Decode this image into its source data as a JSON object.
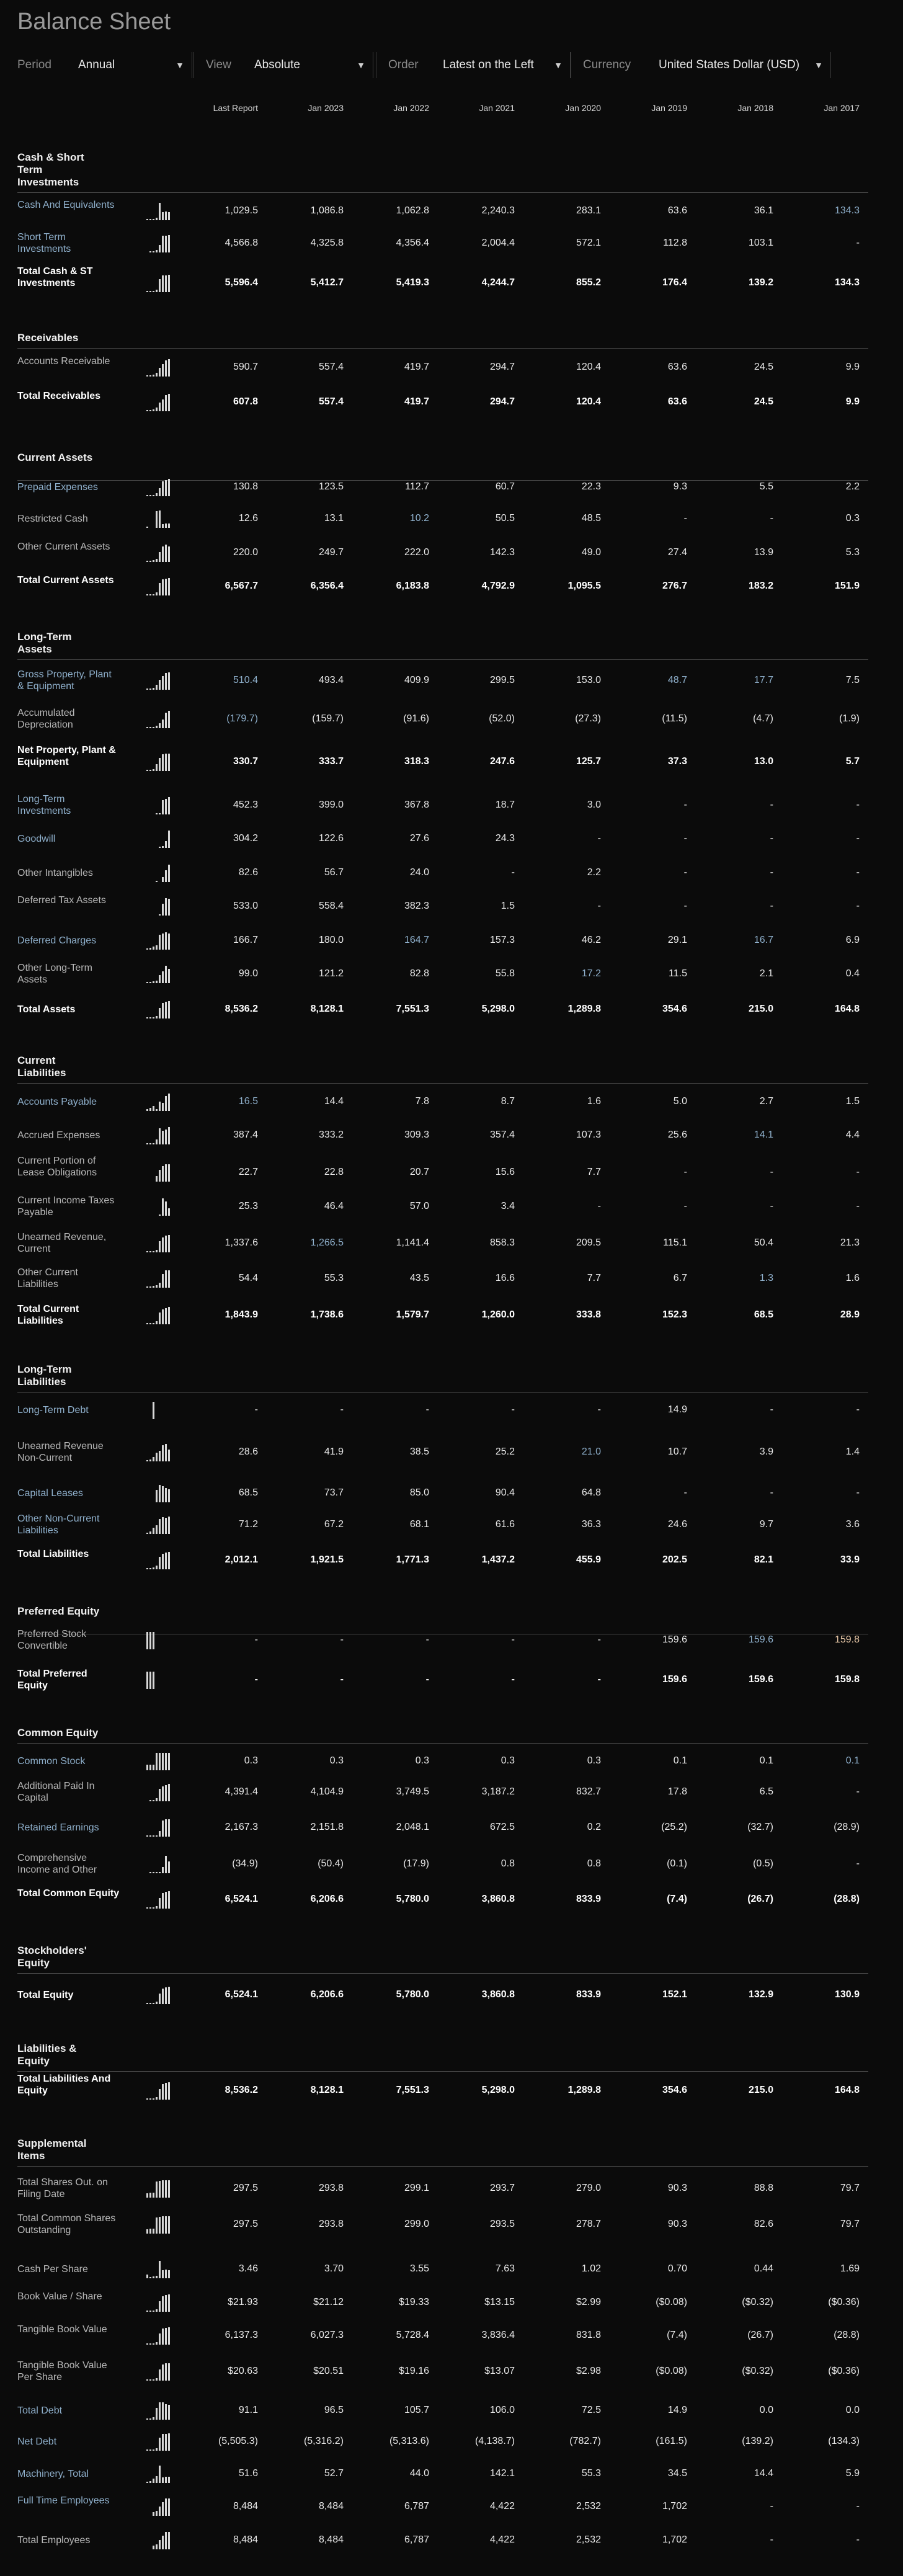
{
  "title": "Balance Sheet",
  "controls": [
    {
      "label": "Period",
      "value": "Annual"
    },
    {
      "label": "View",
      "value": "Absolute"
    },
    {
      "label": "Order",
      "value": "Latest on the Left"
    },
    {
      "label": "Currency",
      "value": "United States Dollar (USD)"
    }
  ],
  "caret_icon": "▼",
  "columns": [
    "Last Report",
    "Jan 2023",
    "Jan 2022",
    "Jan 2021",
    "Jan 2020",
    "Jan 2019",
    "Jan 2018",
    "Jan 2017"
  ],
  "colors": {
    "link": "#8fb0cc",
    "amber": "#e8c8a8",
    "bg": "#0b0b0b"
  },
  "sections": [
    {
      "title": "Cash & Short Term Investments",
      "rows": [
        {
          "label": "Cash And Equivalents",
          "style": "link",
          "values": [
            "1,029.5",
            "1,086.8",
            "1,062.8",
            "2,240.3",
            "283.1",
            "63.6",
            "36.1",
            "134.3"
          ],
          "blue": [
            7
          ]
        },
        {
          "label": "Short Term Investments",
          "style": "link",
          "values": [
            "4,566.8",
            "4,325.8",
            "4,356.4",
            "2,004.4",
            "572.1",
            "112.8",
            "103.1",
            "-"
          ]
        },
        {
          "label": "Total Cash & ST Investments",
          "style": "total",
          "values": [
            "5,596.4",
            "5,412.7",
            "5,419.3",
            "4,244.7",
            "855.2",
            "176.4",
            "139.2",
            "134.3"
          ]
        }
      ]
    },
    {
      "title": "Receivables",
      "rows": [
        {
          "label": "Accounts Receivable",
          "style": "plain",
          "values": [
            "590.7",
            "557.4",
            "419.7",
            "294.7",
            "120.4",
            "63.6",
            "24.5",
            "9.9"
          ]
        },
        {
          "label": "Total Receivables",
          "style": "total",
          "values": [
            "607.8",
            "557.4",
            "419.7",
            "294.7",
            "120.4",
            "63.6",
            "24.5",
            "9.9"
          ]
        }
      ]
    },
    {
      "title": "Current Assets",
      "rows": [
        {
          "label": "Prepaid Expenses",
          "style": "link",
          "values": [
            "130.8",
            "123.5",
            "112.7",
            "60.7",
            "22.3",
            "9.3",
            "5.5",
            "2.2"
          ]
        },
        {
          "label": "Restricted Cash",
          "style": "plain",
          "values": [
            "12.6",
            "13.1",
            "10.2",
            "50.5",
            "48.5",
            "-",
            "-",
            "0.3"
          ],
          "blue": [
            2
          ]
        },
        {
          "label": "Other Current Assets",
          "style": "plain",
          "values": [
            "220.0",
            "249.7",
            "222.0",
            "142.3",
            "49.0",
            "27.4",
            "13.9",
            "5.3"
          ]
        },
        {
          "label": "Total Current Assets",
          "style": "total",
          "values": [
            "6,567.7",
            "6,356.4",
            "6,183.8",
            "4,792.9",
            "1,095.5",
            "276.7",
            "183.2",
            "151.9"
          ]
        }
      ]
    },
    {
      "title": "Long-Term Assets",
      "rows": [
        {
          "label": "Gross Property, Plant & Equipment",
          "style": "link",
          "values": [
            "510.4",
            "493.4",
            "409.9",
            "299.5",
            "153.0",
            "48.7",
            "17.7",
            "7.5"
          ],
          "blue": [
            0,
            5,
            6
          ]
        },
        {
          "label": "Accumulated Depreciation",
          "style": "plain",
          "values": [
            "(179.7)",
            "(159.7)",
            "(91.6)",
            "(52.0)",
            "(27.3)",
            "(11.5)",
            "(4.7)",
            "(1.9)"
          ],
          "blue": [
            0
          ]
        },
        {
          "label": "Net Property, Plant & Equipment",
          "style": "total",
          "values": [
            "330.7",
            "333.7",
            "318.3",
            "247.6",
            "125.7",
            "37.3",
            "13.0",
            "5.7"
          ]
        },
        {
          "label": "Long-Term Investments",
          "style": "link",
          "values": [
            "452.3",
            "399.0",
            "367.8",
            "18.7",
            "3.0",
            "-",
            "-",
            "-"
          ]
        },
        {
          "label": "Goodwill",
          "style": "link",
          "values": [
            "304.2",
            "122.6",
            "27.6",
            "24.3",
            "-",
            "-",
            "-",
            "-"
          ]
        },
        {
          "label": "Other Intangibles",
          "style": "plain",
          "values": [
            "82.6",
            "56.7",
            "24.0",
            "-",
            "2.2",
            "-",
            "-",
            "-"
          ]
        },
        {
          "label": "Deferred Tax Assets",
          "style": "plain",
          "values": [
            "533.0",
            "558.4",
            "382.3",
            "1.5",
            "-",
            "-",
            "-",
            "-"
          ]
        },
        {
          "label": "Deferred Charges",
          "style": "link",
          "values": [
            "166.7",
            "180.0",
            "164.7",
            "157.3",
            "46.2",
            "29.1",
            "16.7",
            "6.9"
          ],
          "blue": [
            2,
            6
          ]
        },
        {
          "label": "Other Long-Term Assets",
          "style": "plain",
          "values": [
            "99.0",
            "121.2",
            "82.8",
            "55.8",
            "17.2",
            "11.5",
            "2.1",
            "0.4"
          ],
          "blue": [
            4
          ]
        },
        {
          "label": "Total Assets",
          "style": "total",
          "values": [
            "8,536.2",
            "8,128.1",
            "7,551.3",
            "5,298.0",
            "1,289.8",
            "354.6",
            "215.0",
            "164.8"
          ]
        }
      ]
    },
    {
      "title": "Current Liabilities",
      "rows": [
        {
          "label": "Accounts Payable",
          "style": "link",
          "values": [
            "16.5",
            "14.4",
            "7.8",
            "8.7",
            "1.6",
            "5.0",
            "2.7",
            "1.5"
          ],
          "blue": [
            0
          ]
        },
        {
          "label": "Accrued Expenses",
          "style": "plain",
          "values": [
            "387.4",
            "333.2",
            "309.3",
            "357.4",
            "107.3",
            "25.6",
            "14.1",
            "4.4"
          ],
          "blue": [
            6
          ]
        },
        {
          "label": "Current Portion of Lease Obligations",
          "style": "plain",
          "values": [
            "22.7",
            "22.8",
            "20.7",
            "15.6",
            "7.7",
            "-",
            "-",
            "-"
          ]
        },
        {
          "label": "Current Income Taxes Payable",
          "style": "plain",
          "values": [
            "25.3",
            "46.4",
            "57.0",
            "3.4",
            "-",
            "-",
            "-",
            "-"
          ]
        },
        {
          "label": "Unearned Revenue, Current",
          "style": "plain",
          "values": [
            "1,337.6",
            "1,266.5",
            "1,141.4",
            "858.3",
            "209.5",
            "115.1",
            "50.4",
            "21.3"
          ],
          "blue": [
            1
          ]
        },
        {
          "label": "Other Current Liabilities",
          "style": "plain",
          "values": [
            "54.4",
            "55.3",
            "43.5",
            "16.6",
            "7.7",
            "6.7",
            "1.3",
            "1.6"
          ],
          "blue": [
            6
          ]
        },
        {
          "label": "Total Current Liabilities",
          "style": "total",
          "values": [
            "1,843.9",
            "1,738.6",
            "1,579.7",
            "1,260.0",
            "333.8",
            "152.3",
            "68.5",
            "28.9"
          ]
        }
      ]
    },
    {
      "title": "Long-Term Liabilities",
      "rows": [
        {
          "label": "Long-Term Debt",
          "style": "link",
          "values": [
            "-",
            "-",
            "-",
            "-",
            "-",
            "14.9",
            "-",
            "-"
          ]
        },
        {
          "label": "Unearned Revenue Non-Current",
          "style": "plain",
          "values": [
            "28.6",
            "41.9",
            "38.5",
            "25.2",
            "21.0",
            "10.7",
            "3.9",
            "1.4"
          ],
          "blue": [
            4
          ]
        },
        {
          "label": "Capital Leases",
          "style": "link",
          "values": [
            "68.5",
            "73.7",
            "85.0",
            "90.4",
            "64.8",
            "-",
            "-",
            "-"
          ]
        },
        {
          "label": "Other Non-Current Liabilities",
          "style": "link",
          "values": [
            "71.2",
            "67.2",
            "68.1",
            "61.6",
            "36.3",
            "24.6",
            "9.7",
            "3.6"
          ]
        },
        {
          "label": "Total Liabilities",
          "style": "total",
          "values": [
            "2,012.1",
            "1,921.5",
            "1,771.3",
            "1,437.2",
            "455.9",
            "202.5",
            "82.1",
            "33.9"
          ]
        }
      ]
    },
    {
      "title": "Preferred Equity",
      "rows": [
        {
          "label": "Preferred Stock Convertible",
          "style": "plain",
          "values": [
            "-",
            "-",
            "-",
            "-",
            "-",
            "159.6",
            "159.6",
            "159.8"
          ],
          "blue": [
            6
          ],
          "amber": [
            7
          ]
        },
        {
          "label": "Total Preferred Equity",
          "style": "total",
          "values": [
            "-",
            "-",
            "-",
            "-",
            "-",
            "159.6",
            "159.6",
            "159.8"
          ]
        }
      ]
    },
    {
      "title": "Common Equity",
      "rows": [
        {
          "label": "Common Stock",
          "style": "link",
          "values": [
            "0.3",
            "0.3",
            "0.3",
            "0.3",
            "0.3",
            "0.1",
            "0.1",
            "0.1"
          ],
          "blue": [
            7
          ]
        },
        {
          "label": "Additional Paid In Capital",
          "style": "plain",
          "values": [
            "4,391.4",
            "4,104.9",
            "3,749.5",
            "3,187.2",
            "832.7",
            "17.8",
            "6.5",
            "-"
          ]
        },
        {
          "label": "Retained Earnings",
          "style": "link",
          "values": [
            "2,167.3",
            "2,151.8",
            "2,048.1",
            "672.5",
            "0.2",
            "(25.2)",
            "(32.7)",
            "(28.9)"
          ]
        },
        {
          "label": "Comprehensive Income and Other",
          "style": "plain",
          "values": [
            "(34.9)",
            "(50.4)",
            "(17.9)",
            "0.8",
            "0.8",
            "(0.1)",
            "(0.5)",
            "-"
          ]
        },
        {
          "label": "Total Common Equity",
          "style": "total",
          "values": [
            "6,524.1",
            "6,206.6",
            "5,780.0",
            "3,860.8",
            "833.9",
            "(7.4)",
            "(26.7)",
            "(28.8)"
          ]
        }
      ]
    },
    {
      "title": "Stockholders' Equity",
      "rows": [
        {
          "label": "Total Equity",
          "style": "total",
          "values": [
            "6,524.1",
            "6,206.6",
            "5,780.0",
            "3,860.8",
            "833.9",
            "152.1",
            "132.9",
            "130.9"
          ]
        }
      ]
    },
    {
      "title": "Liabilities & Equity",
      "rows": [
        {
          "label": "Total Liabilities And Equity",
          "style": "total",
          "values": [
            "8,536.2",
            "8,128.1",
            "7,551.3",
            "5,298.0",
            "1,289.8",
            "354.6",
            "215.0",
            "164.8"
          ]
        }
      ]
    },
    {
      "title": "Supplemental Items",
      "rows": [
        {
          "label": "Total Shares Out. on Filing Date",
          "style": "plain",
          "values": [
            "297.5",
            "293.8",
            "299.1",
            "293.7",
            "279.0",
            "90.3",
            "88.8",
            "79.7"
          ]
        },
        {
          "label": "Total Common Shares Outstanding",
          "style": "plain",
          "values": [
            "297.5",
            "293.8",
            "299.0",
            "293.5",
            "278.7",
            "90.3",
            "82.6",
            "79.7"
          ]
        },
        {
          "label": "Cash Per Share",
          "style": "plain",
          "values": [
            "3.46",
            "3.70",
            "3.55",
            "7.63",
            "1.02",
            "0.70",
            "0.44",
            "1.69"
          ]
        },
        {
          "label": "Book Value / Share",
          "style": "plain",
          "values": [
            "$21.93",
            "$21.12",
            "$19.33",
            "$13.15",
            "$2.99",
            "($0.08)",
            "($0.32)",
            "($0.36)"
          ]
        },
        {
          "label": "Tangible Book Value",
          "style": "plain",
          "values": [
            "6,137.3",
            "6,027.3",
            "5,728.4",
            "3,836.4",
            "831.8",
            "(7.4)",
            "(26.7)",
            "(28.8)"
          ]
        },
        {
          "label": "Tangible Book Value Per Share",
          "style": "plain",
          "values": [
            "$20.63",
            "$20.51",
            "$19.16",
            "$13.07",
            "$2.98",
            "($0.08)",
            "($0.32)",
            "($0.36)"
          ]
        },
        {
          "label": "Total Debt",
          "style": "link",
          "values": [
            "91.1",
            "96.5",
            "105.7",
            "106.0",
            "72.5",
            "14.9",
            "0.0",
            "0.0"
          ]
        },
        {
          "label": "Net Debt",
          "style": "link",
          "values": [
            "(5,505.3)",
            "(5,316.2)",
            "(5,313.6)",
            "(4,138.7)",
            "(782.7)",
            "(161.5)",
            "(139.2)",
            "(134.3)"
          ]
        },
        {
          "label": "Machinery, Total",
          "style": "link",
          "values": [
            "51.6",
            "52.7",
            "44.0",
            "142.1",
            "55.3",
            "34.5",
            "14.4",
            "5.9"
          ]
        },
        {
          "label": "Full Time Employees",
          "style": "link",
          "values": [
            "8,484",
            "8,484",
            "6,787",
            "4,422",
            "2,532",
            "1,702",
            "-",
            "-"
          ]
        },
        {
          "label": "Total Employees",
          "style": "plain",
          "values": [
            "8,484",
            "8,484",
            "6,787",
            "4,422",
            "2,532",
            "1,702",
            "-",
            "-"
          ]
        }
      ]
    }
  ]
}
